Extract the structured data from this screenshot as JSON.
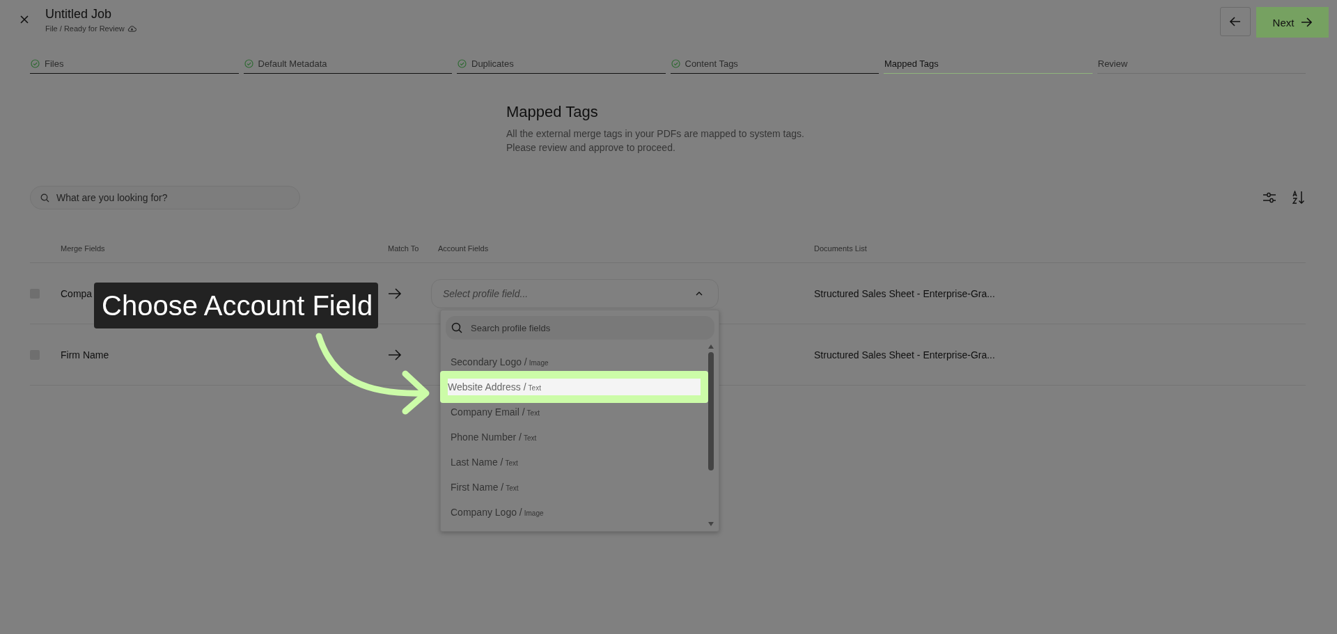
{
  "header": {
    "title": "Untitled Job",
    "subtitle": "File / Ready for Review",
    "next_button": "Next"
  },
  "steps": [
    {
      "label": "Files",
      "completed": true,
      "selected": false
    },
    {
      "label": "Default Metadata",
      "completed": true,
      "selected": false
    },
    {
      "label": "Duplicates",
      "completed": true,
      "selected": false
    },
    {
      "label": "Content Tags",
      "completed": true,
      "selected": false
    },
    {
      "label": "Mapped Tags",
      "completed": false,
      "selected": true
    },
    {
      "label": "Review",
      "completed": false,
      "selected": false
    }
  ],
  "intro": {
    "heading": "Mapped Tags",
    "lines": [
      "All the external merge tags in your PDFs are mapped to system tags.",
      "Please review and approve to proceed."
    ]
  },
  "search": {
    "placeholder": "What are you looking for?"
  },
  "table": {
    "columns": [
      "Merge Fields",
      "Match To",
      "Account Fields",
      "Documents List"
    ],
    "rows": [
      {
        "merge_field": "Compa",
        "checked": false,
        "document": "Structured Sales Sheet - Enterprise-Gra..."
      },
      {
        "merge_field": "Firm Name",
        "checked": false,
        "document": "Structured Sales Sheet - Enterprise-Gra..."
      }
    ]
  },
  "dropdown": {
    "placeholder": "Select profile field...",
    "expanded": true,
    "search_placeholder": "Search profile fields",
    "options": [
      {
        "name": "Secondary Logo",
        "separator": "/",
        "type": "Image",
        "selected": false
      },
      {
        "name": "Website Address",
        "separator": "/",
        "type": "Text",
        "selected": true
      },
      {
        "name": "Company Email",
        "separator": "/",
        "type": "Text",
        "selected": false
      },
      {
        "name": "Phone Number",
        "separator": "/",
        "type": "Text",
        "selected": false
      },
      {
        "name": "Last Name",
        "separator": "/",
        "type": "Text",
        "selected": false
      },
      {
        "name": "First Name",
        "separator": "/",
        "type": "Text",
        "selected": false
      },
      {
        "name": "Company Logo",
        "separator": "/",
        "type": "Image",
        "selected": false
      }
    ]
  },
  "callout": {
    "text": "Choose Account Field"
  }
}
